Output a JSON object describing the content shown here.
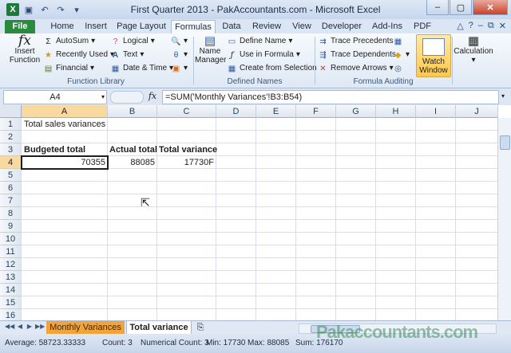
{
  "window": {
    "title": "First Quarter 2013 - PakAccountants.com - Microsoft Excel",
    "controls": [
      "–",
      "▢",
      "✕"
    ]
  },
  "ribbon_tabs": [
    "File",
    "Home",
    "Insert",
    "Page Layout",
    "Formulas",
    "Data",
    "Review",
    "View",
    "Developer",
    "Add-Ins",
    "PDF"
  ],
  "active_tab": "Formulas",
  "function_library": {
    "label": "Function Library",
    "insert_function": "Insert Function",
    "autosum": "AutoSum",
    "recently_used": "Recently Used",
    "financial": "Financial",
    "logical": "Logical",
    "text": "Text",
    "date_time": "Date & Time"
  },
  "defined_names": {
    "label": "Defined Names",
    "name_manager": "Name Manager",
    "define_name": "Define Name",
    "use_in_formula": "Use in Formula",
    "create_from_selection": "Create from Selection"
  },
  "formula_auditing": {
    "label": "Formula Auditing",
    "trace_precedents": "Trace Precedents",
    "trace_dependents": "Trace Dependents",
    "remove_arrows": "Remove Arrows",
    "watch_window": "Watch Window"
  },
  "calculation": {
    "label": "Calculation"
  },
  "formula_bar": {
    "name_box": "A4",
    "fx": "fx",
    "formula": "=SUM('Monthly Variances'!B3:B54)"
  },
  "columns": [
    "A",
    "B",
    "C",
    "D",
    "E",
    "F",
    "G",
    "H",
    "I",
    "J"
  ],
  "rows": [
    "1",
    "2",
    "3",
    "4",
    "5",
    "6",
    "7",
    "8",
    "9",
    "10",
    "11",
    "12",
    "13",
    "14",
    "15",
    "16"
  ],
  "cells": {
    "A1": "Total sales variances",
    "A3": "Budgeted total",
    "B3": "Actual total",
    "C3": "Total variance",
    "A4": "70355",
    "B4": "88085",
    "C4": "17730F"
  },
  "sheets": [
    "Monthly Variances",
    "Total variance"
  ],
  "active_sheet": "Total variance",
  "status": {
    "average": "Average: 58723.33333",
    "count": "Count: 3",
    "numerical_count": "Numerical Count: 3",
    "min": "Min: 17730",
    "max": "Max: 88085",
    "sum": "Sum: 176170"
  },
  "watermark": "Pakaccountants.com",
  "colors": {
    "file_tab": "#2b8a3e",
    "sheet_tab_orange": "#f2a33a",
    "watch_window": "#ffc84a",
    "selected_header": "#f9d99f"
  }
}
